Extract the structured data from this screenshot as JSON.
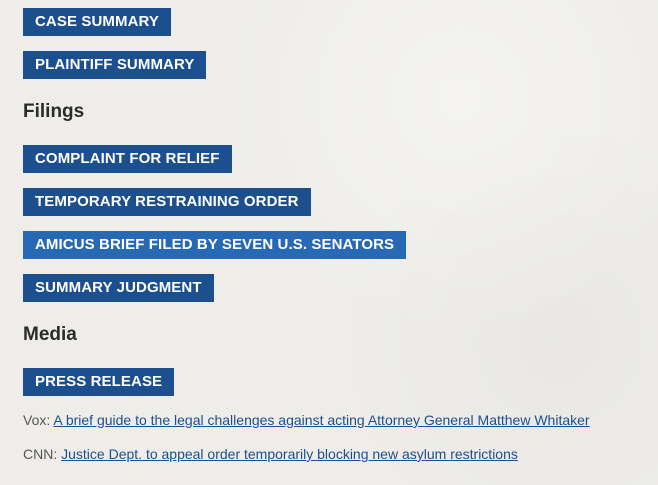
{
  "summary_buttons": [
    {
      "label": "CASE SUMMARY"
    },
    {
      "label": "PLAINTIFF SUMMARY"
    }
  ],
  "filings": {
    "heading": "Filings",
    "buttons": [
      {
        "label": "COMPLAINT FOR RELIEF"
      },
      {
        "label": "TEMPORARY RESTRAINING ORDER"
      },
      {
        "label": "AMICUS BRIEF FILED BY SEVEN U.S. SENATORS"
      },
      {
        "label": "SUMMARY JUDGMENT"
      }
    ]
  },
  "media": {
    "heading": "Media",
    "press_release_label": "PRESS RELEASE",
    "articles": [
      {
        "source": "Vox:",
        "title": "A brief guide to the legal challenges against acting Attorney General Matthew Whitaker"
      },
      {
        "source": "CNN:",
        "title": "Justice Dept. to appeal order temporarily blocking new asylum restrictions"
      }
    ]
  },
  "colors": {
    "button_bg": "#1c4f8e",
    "button_hover_bg": "#2869b5",
    "button_text": "#ffffff",
    "link": "#1c4f8e",
    "heading": "#2b2b2b",
    "page_bg": "#eeedea"
  }
}
